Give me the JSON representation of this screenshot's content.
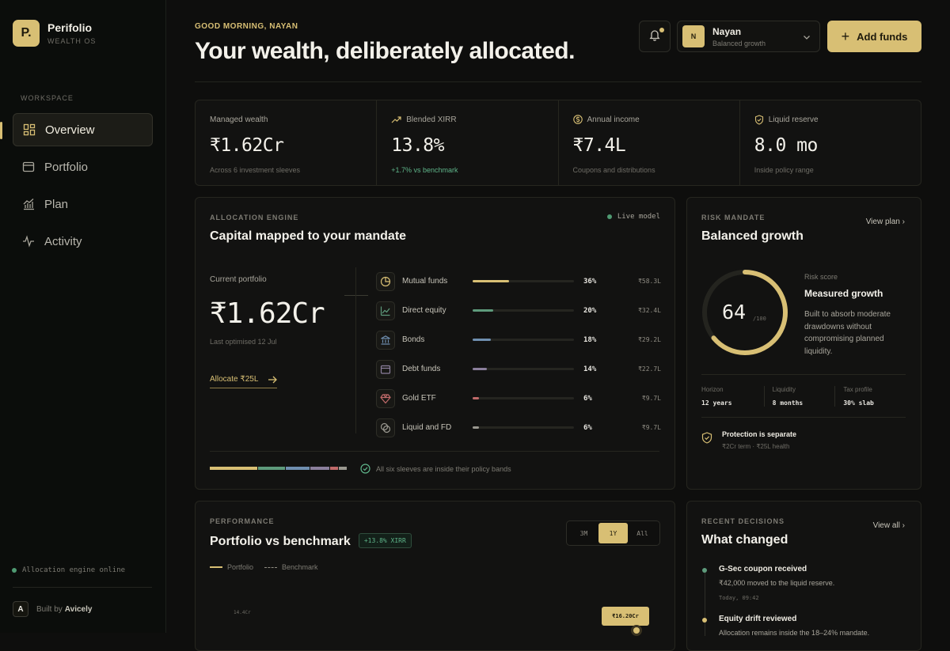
{
  "brand": {
    "name": "Perifolio",
    "sub": "WEALTH OS",
    "logo_letter": "P."
  },
  "sidebar": {
    "section_label": "WORKSPACE",
    "items": [
      {
        "label": "Overview",
        "icon": "grid-icon"
      },
      {
        "label": "Portfolio",
        "icon": "wallet-icon"
      },
      {
        "label": "Plan",
        "icon": "chart-icon"
      },
      {
        "label": "Activity",
        "icon": "pulse-icon"
      }
    ],
    "engine_status": "Allocation engine online",
    "built_by_letter": "A",
    "built_by_prefix": "Built by",
    "built_by_name": "Avicely"
  },
  "header": {
    "greeting": "GOOD MORNING, NAYAN",
    "headline": "Your wealth, deliberately allocated.",
    "user": {
      "initial": "N",
      "name": "Nayan",
      "mandate": "Balanced growth"
    },
    "add_funds": "Add funds"
  },
  "stats": [
    {
      "label": "Managed wealth",
      "value": "₹1.62Cr",
      "sub": "Across 6 investment sleeves",
      "icon": "none"
    },
    {
      "label": "Blended XIRR",
      "value": "13.8%",
      "sub": "+1.7% vs benchmark",
      "icon": "trend-up-icon"
    },
    {
      "label": "Annual income",
      "value": "₹7.4L",
      "sub": "Coupons and distributions",
      "icon": "coin-icon"
    },
    {
      "label": "Liquid reserve",
      "value": "8.0 mo",
      "sub": "Inside policy range",
      "icon": "shield-icon"
    }
  ],
  "allocation": {
    "kicker": "ALLOCATION ENGINE",
    "title": "Capital mapped to your mandate",
    "live": "Live model",
    "current_label": "Current portfolio",
    "current_value": "₹1.62Cr",
    "last_optimised": "Last optimised 12 Jul",
    "cta": "Allocate ₹25L",
    "rows": [
      {
        "name": "Mutual funds",
        "pct": "36%",
        "amount": "₹58.3L",
        "share": 0.36,
        "color": "#d8bf74"
      },
      {
        "name": "Direct equity",
        "pct": "20%",
        "amount": "₹32.4L",
        "share": 0.2,
        "color": "#5e9b7c"
      },
      {
        "name": "Bonds",
        "pct": "18%",
        "amount": "₹29.2L",
        "share": 0.18,
        "color": "#6f8fb0"
      },
      {
        "name": "Debt funds",
        "pct": "14%",
        "amount": "₹22.7L",
        "share": 0.14,
        "color": "#8b7f9c"
      },
      {
        "name": "Gold ETF",
        "pct": "6%",
        "amount": "₹9.7L",
        "share": 0.06,
        "color": "#c06a6a"
      },
      {
        "name": "Liquid and FD",
        "pct": "6%",
        "amount": "₹9.7L",
        "share": 0.06,
        "color": "#9a9890"
      }
    ],
    "footnote": "All six sleeves are inside their policy bands"
  },
  "risk": {
    "kicker": "RISK MANDATE",
    "title": "Balanced growth",
    "view_plan": "View plan",
    "score": "64",
    "score_max": "/100",
    "score_fraction": 0.64,
    "score_label": "Risk score",
    "score_title": "Measured growth",
    "score_desc": "Built to absorb moderate drawdowns without compromising planned liquidity.",
    "metrics": [
      {
        "label": "Horizon",
        "value": "12 years"
      },
      {
        "label": "Liquidity",
        "value": "8 months"
      },
      {
        "label": "Tax profile",
        "value": "30% slab"
      }
    ],
    "protection_title": "Protection is separate",
    "protection_sub": "₹2Cr term · ₹25L health"
  },
  "performance": {
    "kicker": "PERFORMANCE",
    "title": "Portfolio vs benchmark",
    "xirr_badge": "+13.8% XIRR",
    "ranges": [
      "3M",
      "1Y",
      "All"
    ],
    "active_range": "1Y",
    "legend_portfolio": "Portfolio",
    "legend_benchmark": "Benchmark",
    "y_tick": "14.4Cr",
    "tooltip": "₹16.20Cr"
  },
  "recent": {
    "kicker": "RECENT DECISIONS",
    "title": "What changed",
    "view_all": "View all",
    "events": [
      {
        "title": "G-Sec coupon received",
        "sub": "₹42,000 moved to the liquid reserve.",
        "time": "Today, 09:42",
        "color": "#5e9b7c"
      },
      {
        "title": "Equity drift reviewed",
        "sub": "Allocation remains inside the 18–24% mandate.",
        "time": "",
        "color": "#d8bf74"
      }
    ]
  }
}
